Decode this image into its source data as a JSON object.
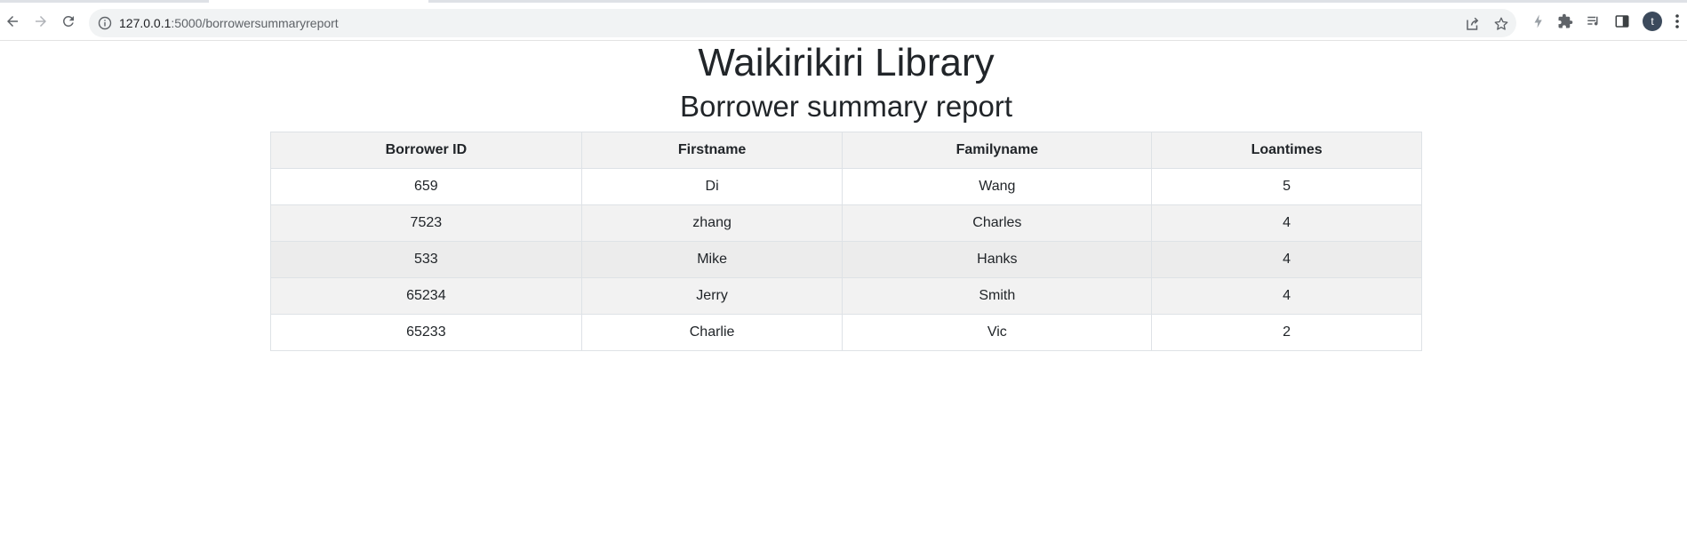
{
  "browser": {
    "url_host": "127.0.0.1",
    "url_path": ":5000/borrowersummaryreport",
    "avatar_letter": "t",
    "icons": [
      "back-icon",
      "forward-icon",
      "reload-icon",
      "site-info-icon",
      "share-icon",
      "bookmark-star-icon",
      "lightning-icon",
      "extensions-puzzle-icon",
      "reading-list-icon",
      "side-panel-icon",
      "profile-avatar",
      "menu-kebab-icon"
    ]
  },
  "page": {
    "title": "Waikirikiri Library",
    "subtitle": "Borrower summary report"
  },
  "table": {
    "headers": [
      "Borrower ID",
      "Firstname",
      "Familyname",
      "Loantimes"
    ],
    "rows": [
      [
        "659",
        "Di",
        "Wang",
        "5"
      ],
      [
        "7523",
        "zhang",
        "Charles",
        "4"
      ],
      [
        "533",
        "Mike",
        "Hanks",
        "4"
      ],
      [
        "65234",
        "Jerry",
        "Smith",
        "4"
      ],
      [
        "65233",
        "Charlie",
        "Vic",
        "2"
      ]
    ]
  },
  "colors": {
    "border": "#dee2e6",
    "stripe": "#f2f2f2",
    "text": "#212529"
  }
}
